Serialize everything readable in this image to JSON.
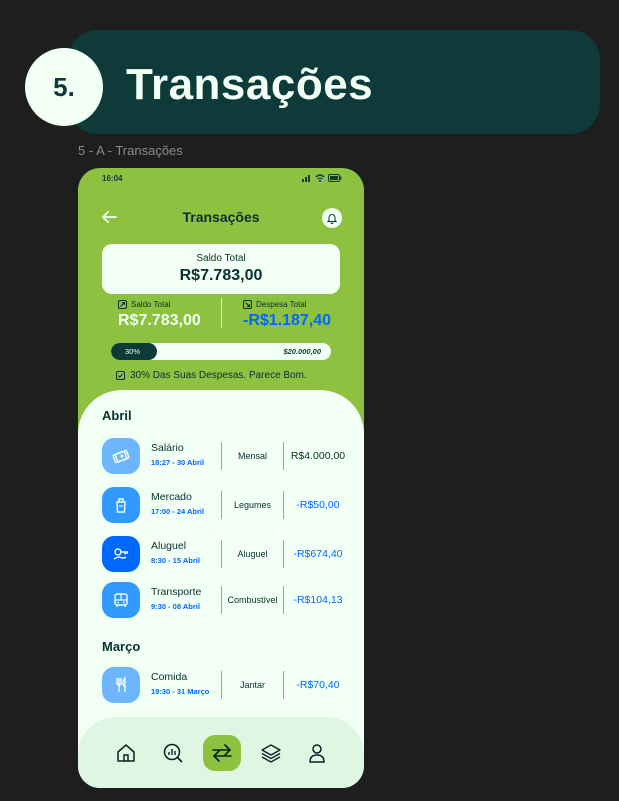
{
  "banner": {
    "number": "5.",
    "title": "Transações"
  },
  "frame_label": "5 - A - Transações",
  "status_bar": {
    "time": "16:04"
  },
  "header": {
    "title": "Transações"
  },
  "saldo_card": {
    "label": "Saldo Total",
    "value": "R$7.783,00"
  },
  "stats": {
    "saldo": {
      "label": "Saldo Total",
      "value": "R$7.783,00"
    },
    "despesa": {
      "label": "Despesa Total",
      "value": "-R$1.187,40"
    }
  },
  "progress": {
    "percent_label": "30%",
    "fraction": 0.21,
    "max_label": "$20.000,00"
  },
  "note": "30% Das Suas Despesas. Parece Bom.",
  "months": [
    {
      "name": "Abril",
      "transactions": [
        {
          "icon": "money-icon",
          "name": "Salário",
          "date": "18:27 - 30 Abril",
          "category": "Mensal",
          "amount": "R$4.000,00",
          "icon_color": "#6db6fe"
        },
        {
          "icon": "grocery-icon",
          "name": "Mercado",
          "date": "17:00 - 24 Abril",
          "category": "Legumes",
          "amount": "-R$50,00",
          "icon_color": "#3299ff"
        },
        {
          "icon": "key-icon",
          "name": "Aluguel",
          "date": "8:30 - 15 Abril",
          "category": "Aluguel",
          "amount": "-R$674,40",
          "icon_color": "#0068ff"
        },
        {
          "icon": "bus-icon",
          "name": "Transporte",
          "date": "9:30 - 08 Abril",
          "category": "Combustível",
          "amount": "-R$104,13",
          "icon_color": "#3299ff"
        }
      ]
    },
    {
      "name": "Março",
      "transactions": [
        {
          "icon": "cutlery-icon",
          "name": "Comida",
          "date": "19:30 - 31 Março",
          "category": "Jantar",
          "amount": "-R$70,40",
          "icon_color": "#6db6fe"
        }
      ]
    }
  ],
  "nav": [
    {
      "icon": "home-icon",
      "active": false
    },
    {
      "icon": "analysis-icon",
      "active": false
    },
    {
      "icon": "transactions-icon",
      "active": true
    },
    {
      "icon": "layers-icon",
      "active": false
    },
    {
      "icon": "profile-icon",
      "active": false
    }
  ],
  "colors": {
    "primary": "#8ec13f",
    "dark": "#0e3b3a",
    "light": "#f1fff4",
    "blue": "#0068ff"
  }
}
